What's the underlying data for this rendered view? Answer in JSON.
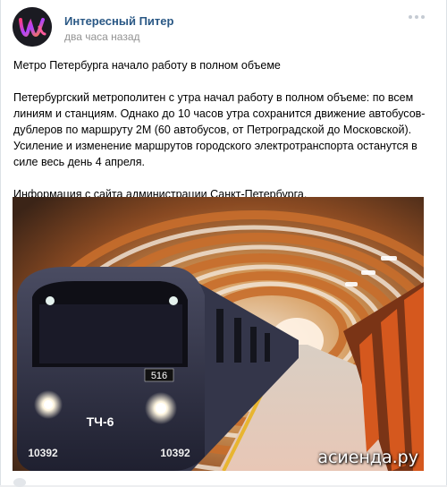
{
  "post": {
    "author": "Интересный Питер",
    "time": "два часа назад",
    "headline": "Метро Петербурга начало работу в полном объеме",
    "body": "Петербургский метрополитен с утра начал работу в полном объеме: по всем линиям и станциям. Однако до 10 часов утра сохранится движение автобусов-дублеров по маршруту 2М (60 автобусов, от Петроградской до Московской). Усиление и изменение маршрутов городского электротранспорта останутся в силе весь день 4 апреля.",
    "source": "Информация с сайта администрации Санкт-Петербурга."
  },
  "photo": {
    "train_label": "ТЧ-6",
    "route_number": "516",
    "car_number_left": "10392",
    "car_number_right": "10392",
    "watermark": "асиенда.ру"
  },
  "icons": {
    "avatar": "community-logo",
    "more": "more-dots-icon"
  },
  "colors": {
    "author": "#2a5885",
    "time": "#939393"
  }
}
